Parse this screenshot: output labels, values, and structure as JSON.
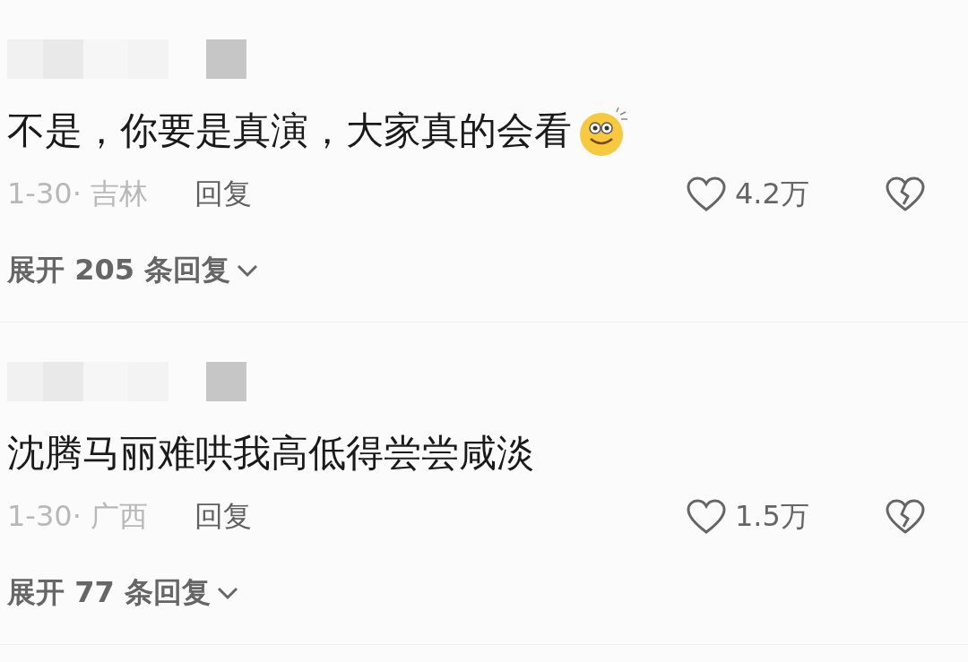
{
  "comments": [
    {
      "text": "不是，你要是真演，大家真的会看",
      "emoji": true,
      "date": "1-30· 吉林",
      "reply": "回复",
      "likes": "4.2万",
      "expand": "展开 205 条回复"
    },
    {
      "text": "沈腾马丽难哄我高低得尝尝咸淡",
      "emoji": false,
      "date": "1-30· 广西",
      "reply": "回复",
      "likes": "1.5万",
      "expand": "展开 77 条回复"
    }
  ]
}
